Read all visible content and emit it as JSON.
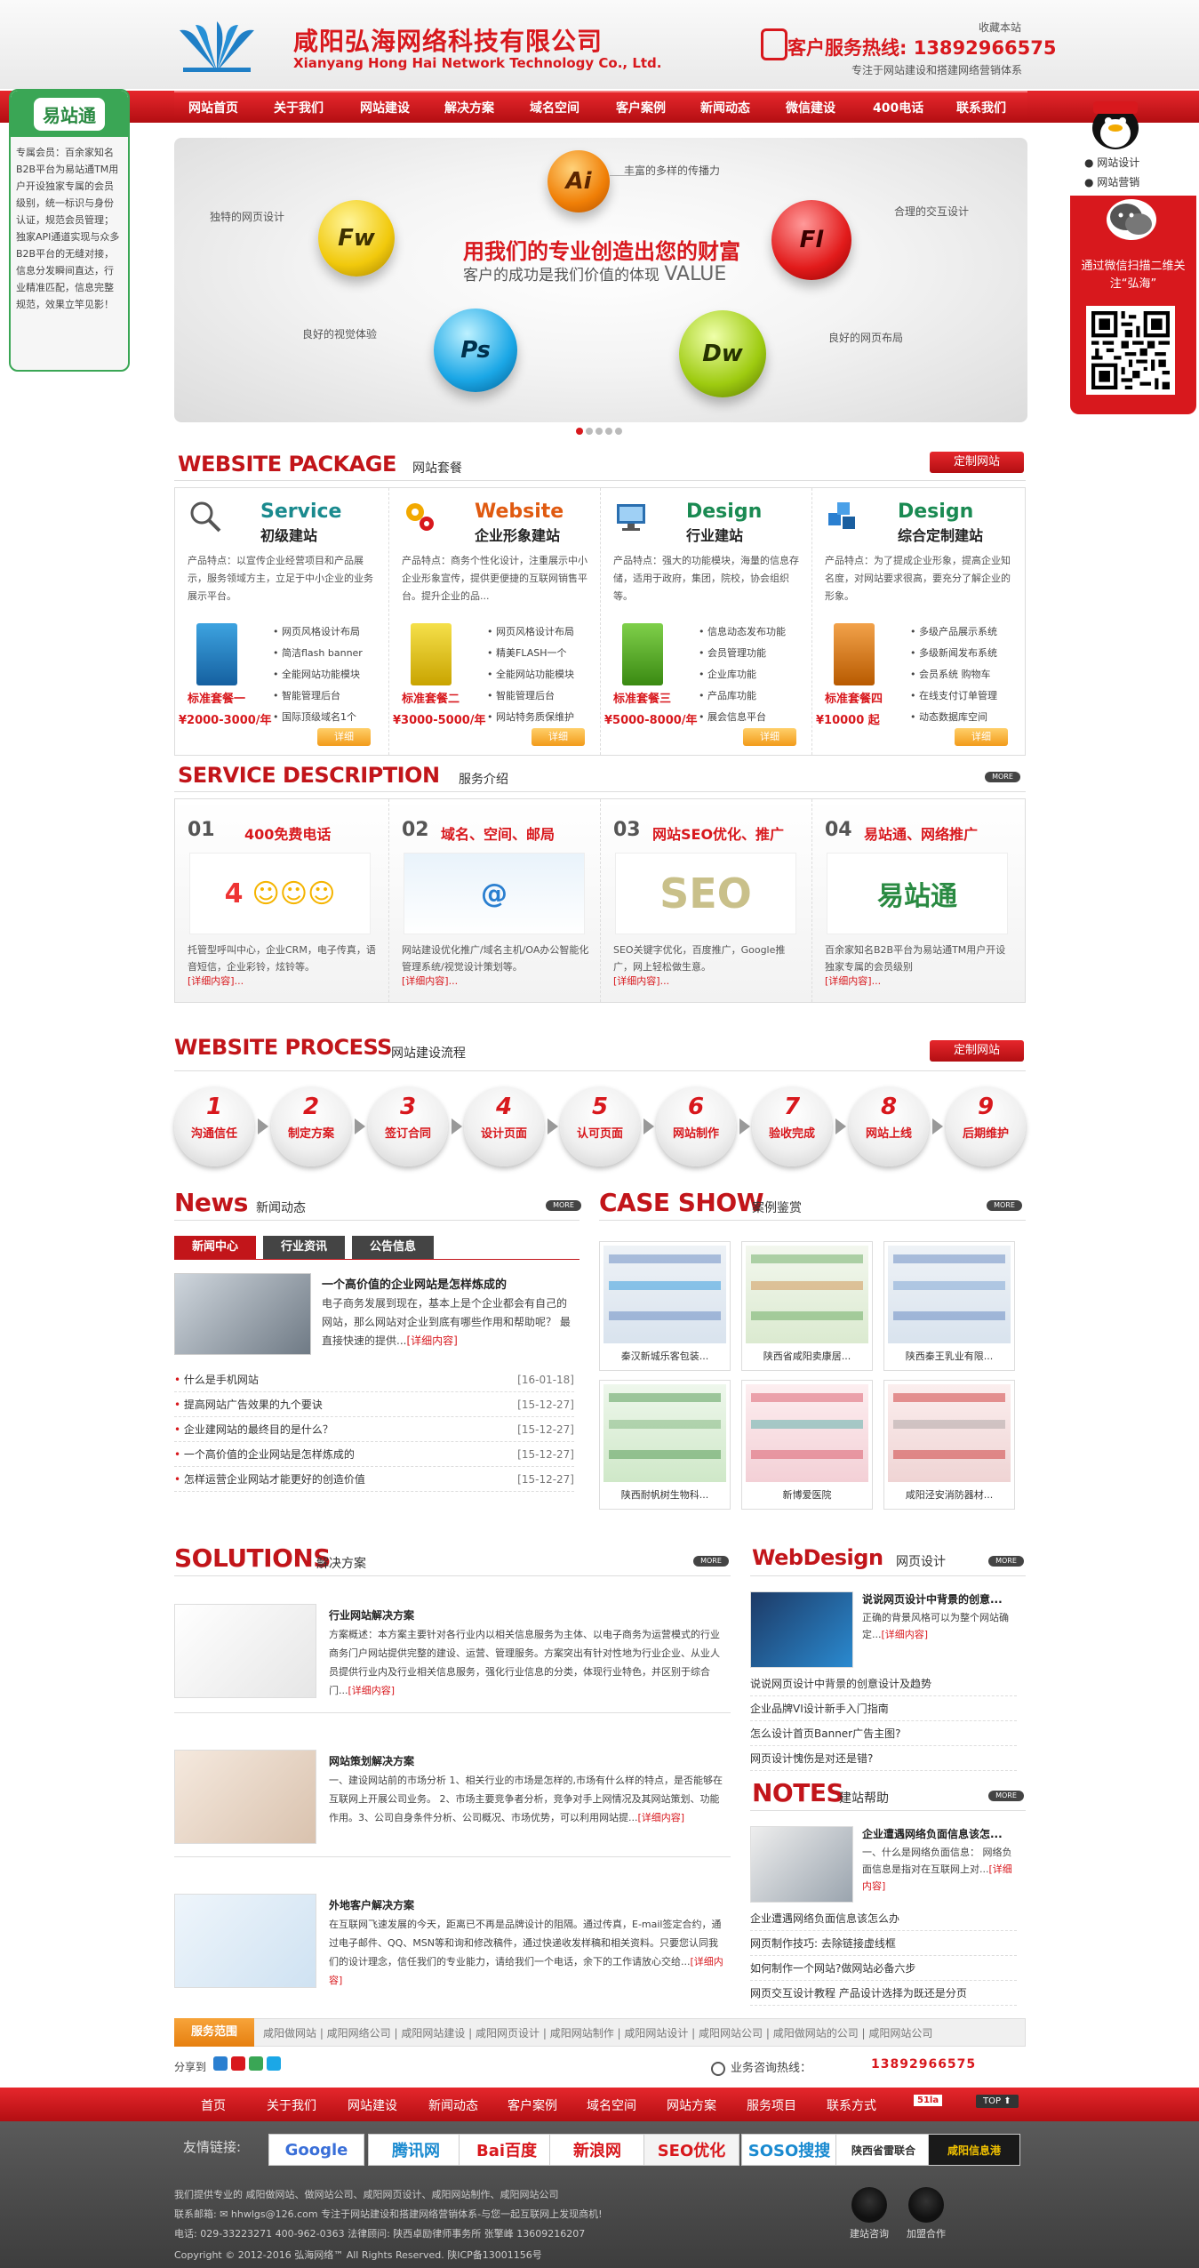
{
  "header": {
    "company_cn": "咸阳弘海网络科技有限公司",
    "company_en": "Xianyang Hong Hai Network Technology Co., Ltd.",
    "hotline": "客户服务热线: 13892966575",
    "favorite": "收藏本站",
    "slogan": "专注于网站建设和搭建网络营销体系"
  },
  "nav": [
    "网站首页",
    "关于我们",
    "网站建设",
    "解决方案",
    "域名空间",
    "客户案例",
    "新闻动态",
    "微信建设",
    "400电话",
    "联系我们"
  ],
  "banner": {
    "headline": "用我们的专业创造出您的财富",
    "subline": "客户的成功是我们价值的体现",
    "value_word": "VALUE",
    "labels": {
      "ai": "丰富的多样的传播力",
      "fw": "独特的网页设计",
      "fl": "合理的交互设计",
      "ps": "良好的视觉体验",
      "dw": "良好的网页布局"
    },
    "balls": {
      "ai": "Ai",
      "fw": "Fw",
      "fl": "Fl",
      "ps": "Ps",
      "dw": "Dw"
    }
  },
  "left_float": {
    "logo": "易站通",
    "text": "专属会员：百余家知名B2B平台为易站通TM用户开设独家专属的会员级别，统一标识与身份认证，规范会员管理；独家API通道实现与众多B2B平台的无缝对接，信息分发瞬间直达，行业精准匹配，信息完整规范，效果立竿见影！"
  },
  "right_float": {
    "link1": "网站设计",
    "link2": "网站营销",
    "caption": "通过微信扫描二维关注“弘海”"
  },
  "package": {
    "title_en": "WEBSITE PACKAGE",
    "title_cn": "网站套餐",
    "button": "定制网站",
    "items": [
      {
        "en": "Service",
        "cn": "初级建站",
        "desc": "产品特点：以宣传企业经营项目和产品展示，服务领域方主，立足于中小企业的业务展示平台。",
        "features": [
          "网页风格设计布局",
          "简洁flash banner",
          "全能网站功能模块",
          "智能管理后台",
          "国际顶级域名1个"
        ],
        "tag": "标准套餐一",
        "price": "2000-3000/年",
        "detail": "详细"
      },
      {
        "en": "Website",
        "cn": "企业形象建站",
        "desc": "产品特点：商务个性化设计，注重展示中小企业形象宣传，提供更便捷的互联网销售平台。提升企业的品...",
        "features": [
          "网页风格设计布局",
          "精美FLASH一个",
          "全能网站功能模块",
          "智能管理后台",
          "网站特务质保维护"
        ],
        "tag": "标准套餐二",
        "price": "3000-5000/年",
        "detail": "详细"
      },
      {
        "en": "Design",
        "cn": "行业建站",
        "desc": "产品特点：强大的功能模块，海量的信息存储，适用于政府，集团，院校，协会组织等。",
        "features": [
          "信息动态发布功能",
          "会员管理功能",
          "企业库功能",
          "产品库功能",
          "展会信息平台"
        ],
        "tag": "标准套餐三",
        "price": "5000-8000/年",
        "detail": "详细"
      },
      {
        "en": "Design",
        "cn": "综合定制建站",
        "desc": "产品特点：为了提成企业形象，提高企业知名度，对网站要求很高，要充分了解企业的形象。",
        "features": [
          "多级产品展示系统",
          "多级新闻发布系统",
          "会员系统 购物车",
          "在线支付订单管理",
          "动态数据库空间"
        ],
        "tag": "标准套餐四",
        "price": "10000 起",
        "detail": "详细"
      }
    ]
  },
  "service": {
    "title_en": "SERVICE DESCRIPTION",
    "title_cn": "服务介绍",
    "more": "MORE",
    "items": [
      {
        "num": "01",
        "title": "400免费电话",
        "img": "4",
        "desc": "托管型呼叫中心，企业CRM，电子传真，语音短信，企业彩铃，炫铃等。",
        "more": "[详细内容]..."
      },
      {
        "num": "02",
        "title": "域名、空间、邮局",
        "img": "@",
        "desc": "网站建设优化推广/域名主机/OA办公智能化管理系统/视觉设计策划等。",
        "more": "[详细内容]..."
      },
      {
        "num": "03",
        "title": "网站SEO优化、推广",
        "img": "SEO",
        "desc": "SEO关键字优化，百度推广，Google推广，网上轻松做生意。",
        "more": "[详细内容]..."
      },
      {
        "num": "04",
        "title": "易站通、网络推广",
        "img": "易站通",
        "desc": "百余家知名B2B平台为易站通TM用户开设独家专属的会员级别",
        "more": "[详细内容]..."
      }
    ]
  },
  "process": {
    "title_en": "WEBSITE PROCESS",
    "title_cn": "网站建设流程",
    "button": "定制网站",
    "steps": [
      {
        "n": "1",
        "label": "沟通信任"
      },
      {
        "n": "2",
        "label": "制定方案"
      },
      {
        "n": "3",
        "label": "签订合同"
      },
      {
        "n": "4",
        "label": "设计页面"
      },
      {
        "n": "5",
        "label": "认可页面"
      },
      {
        "n": "6",
        "label": "网站制作"
      },
      {
        "n": "7",
        "label": "验收完成"
      },
      {
        "n": "8",
        "label": "网站上线"
      },
      {
        "n": "9",
        "label": "后期维护"
      }
    ]
  },
  "news": {
    "title_en": "News",
    "title_cn": "新闻动态",
    "more": "MORE",
    "tabs": [
      "新闻中心",
      "行业资讯",
      "公告信息"
    ],
    "featured_title": "一个高价值的企业网站是怎样炼成的",
    "featured_desc": "电子商务发展到现在，基本上是个企业都会有自己的网站，那么网站对企业到底有哪些作用和帮助呢？ 最直接快速的提供...",
    "featured_more": "[详细内容]",
    "list": [
      {
        "t": "什么是手机网站",
        "d": "[16-01-18]"
      },
      {
        "t": "提高网站广告效果的九个要诀",
        "d": "[15-12-27]"
      },
      {
        "t": "企业建网站的最终目的是什么？",
        "d": "[15-12-27]"
      },
      {
        "t": "一个高价值的企业网站是怎样炼成的",
        "d": "[15-12-27]"
      },
      {
        "t": "怎样运营企业网站才能更好的创造价值",
        "d": "[15-12-27]"
      }
    ]
  },
  "cases": {
    "title_en": "CASE SHOW",
    "title_cn": "案例鉴赏",
    "more": "MORE",
    "items": [
      "秦汉新城乐客包装...",
      "陕西省咸阳卖康居...",
      "陕西秦王乳业有限...",
      "陕西耐帆树生物科...",
      "新博爱医院",
      "咸阳泾安消防器材..."
    ]
  },
  "solutions": {
    "title_en": "SOLUTIONS",
    "title_cn": "解决方案",
    "more": "MORE",
    "items": [
      {
        "title": "行业网站解决方案",
        "desc": "方案概述：本方案主要针对各行业内以相关信息服务为主体、以电子商务为运营模式的行业商务门户网站提供完整的建设、运营、管理服务。方案突出有针对性地为行业企业、从业人员提供行业内及行业相关信息服务，强化行业信息的分类，体现行业特色，并区别于综合门...",
        "more": "[详细内容]"
      },
      {
        "title": "网站策划解决方案",
        "desc": "一、建设网站前的市场分析 1、相关行业的市场是怎样的,市场有什么样的特点，是否能够在互联网上开展公司业务。 2、市场主要竞争者分析，竞争对手上网情况及其网站策划、功能作用。3、公司自身条件分析、公司概况、市场优势，可以利用网站提...",
        "more": "[详细内容]"
      },
      {
        "title": "外地客户解决方案",
        "desc": "在互联网飞速发展的今天，距离已不再是品牌设计的阻隔。通过传真，E-mail签定合约，通过电子邮件、QQ、MSN等和询和修改稿件，通过快递收发样稿和相关资料。只要您认同我们的设计理念，信任我们的专业能力，请给我们一个电话，余下的工作请放心交给...",
        "more": "[详细内容]"
      }
    ]
  },
  "webdesign": {
    "title_en": "WebDesign",
    "title_cn": "网页设计",
    "more": "MORE",
    "featured_title": "说说网页设计中背景的创意...",
    "featured_desc": "正确的背景风格可以为整个网站确定...",
    "featured_more": "[详细内容]",
    "list": [
      "说说网页设计中背景的创意设计及趋势",
      "企业品牌VI设计新手入门指南",
      "怎么设计首页Banner广告主图?",
      "网页设计愧伤是对还是错?"
    ]
  },
  "notes": {
    "title_en": "NOTES",
    "title_cn": "建站帮助",
    "more": "MORE",
    "featured_title": "企业遭遇网络负面信息该怎...",
    "featured_desc": "一、什么是网络负面信息： 网络负面信息是指对在互联网上对...",
    "featured_more": "[详细内容]",
    "list": [
      "企业遭遇网络负面信息该怎么办",
      "网页制作技巧: 去除链接虚线框",
      "如何制作一个网站?做网站必备六步",
      "网页交互设计教程 产品设计选择为既还是分页"
    ]
  },
  "range": {
    "label": "服务范围",
    "text": "咸阳做网站 | 咸阳网络公司 | 咸阳网站建设 | 咸阳网页设计 | 咸阳网站制作 | 咸阳网站设计 | 咸阳网站公司 | 咸阳做网站的公司 | 咸阳网站公司"
  },
  "share": "分享到",
  "consult": {
    "label": "业务咨询热线：",
    "number": "13892966575"
  },
  "footer_nav": [
    "首页",
    "关于我们",
    "网站建设",
    "新闻动态",
    "客户案例",
    "域名空间",
    "网站方案",
    "服务项目",
    "联系方式"
  ],
  "footer_badge": "51la",
  "footer_top": "TOP",
  "friend_label": "友情链接:",
  "friends": [
    "Google",
    "腾讯网",
    "Bai百度",
    "新浪网",
    "SEO优化",
    "SOSO搜搜",
    "陕西省雷联合",
    "咸阳信息港"
  ],
  "footer_lines": [
    "我们提供专业的 咸阳做网站、做网站公司、咸阳网页设计、咸阳网站制作、咸阳网站公司",
    "联系邮箱: ✉ hhwlgs@126.com    专注于网站建设和搭建网络营销体系-与您一起互联网上发现商机!",
    "电话: 029-33223271  400-962-0363  法律顾问: 陕西卓励律师事务所 张擎峰 13609216207",
    "Copyright © 2012-2016 弘海网络™ All Rights Reserved. 陕ICP备13001156号"
  ],
  "footer_qq": [
    "建站咨询",
    "加盟合作"
  ],
  "colors": {
    "brand_red": "#d8181d",
    "green": "#3aa655",
    "orange": "#f29b1a"
  }
}
